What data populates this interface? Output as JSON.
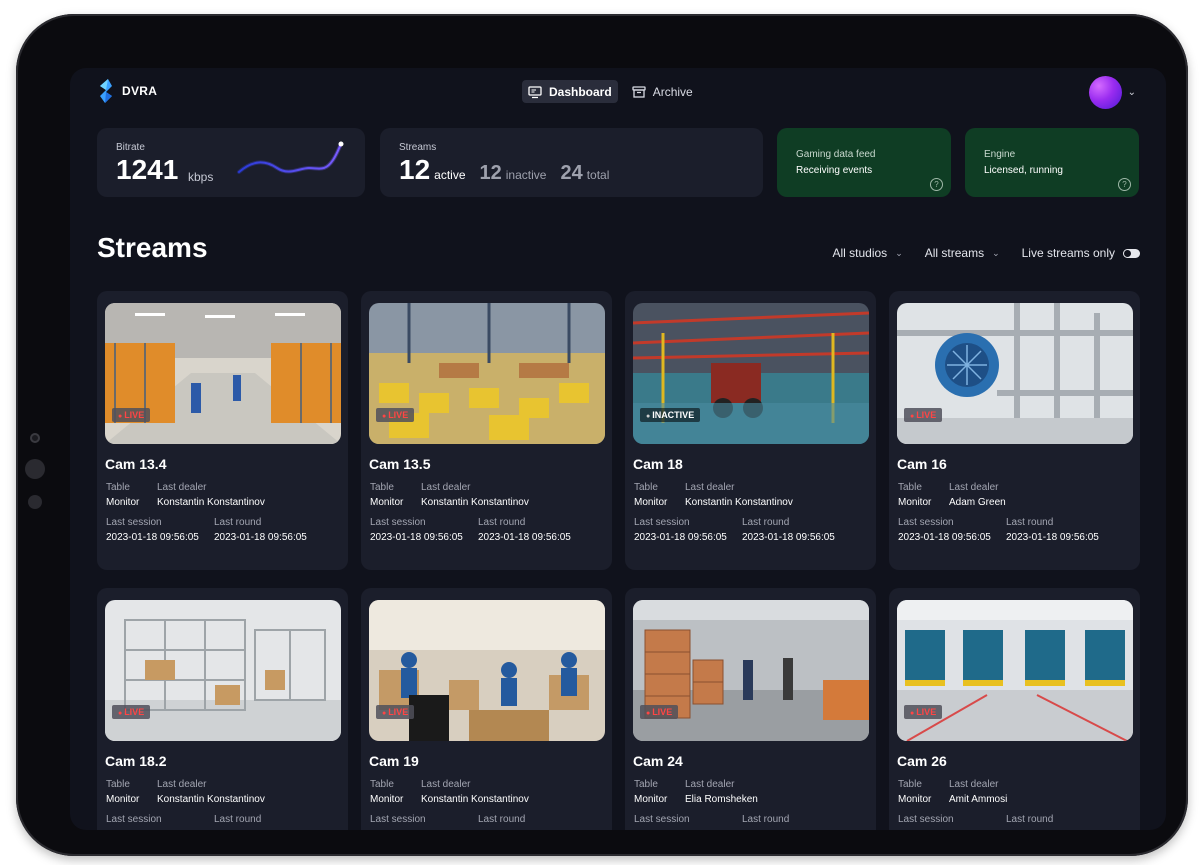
{
  "app": {
    "name": "DVRA"
  },
  "nav": [
    {
      "label": "Dashboard",
      "icon": "monitor-icon",
      "active": true
    },
    {
      "label": "Archive",
      "icon": "archive-box-icon",
      "active": false
    }
  ],
  "stats": {
    "bitrate": {
      "label": "Bitrate",
      "value": "1241",
      "unit": "kbps"
    },
    "streams": {
      "label": "Streams",
      "active": "12",
      "active_label": "active",
      "inactive": "12",
      "inactive_label": "inactive",
      "total": "24",
      "total_label": "total"
    },
    "gaming": {
      "title": "Gaming data feed",
      "status": "Receiving events"
    },
    "engine": {
      "title": "Engine",
      "status": "Licensed, running"
    }
  },
  "page_title": "Streams",
  "filters": {
    "studios": "All studios",
    "streams": "All streams",
    "live_only": "Live streams only"
  },
  "labels": {
    "table": "Table",
    "last_dealer": "Last dealer",
    "last_session": "Last session",
    "last_round": "Last round"
  },
  "cams": [
    {
      "name": "Cam 13.4",
      "status": "LIVE",
      "table": "Monitor",
      "dealer": "Konstantin Konstantinov",
      "session": "2023-01-18 09:56:05",
      "round": "2023-01-18 09:56:05"
    },
    {
      "name": "Cam 13.5",
      "status": "LIVE",
      "table": "Monitor",
      "dealer": "Konstantin Konstantinov",
      "session": "2023-01-18 09:56:05",
      "round": "2023-01-18 09:56:05"
    },
    {
      "name": "Cam 18",
      "status": "INACTIVE",
      "table": "Monitor",
      "dealer": "Konstantin Konstantinov",
      "session": "2023-01-18 09:56:05",
      "round": "2023-01-18 09:56:05"
    },
    {
      "name": "Cam 16",
      "status": "LIVE",
      "table": "Monitor",
      "dealer": "Adam Green",
      "session": "2023-01-18 09:56:05",
      "round": "2023-01-18 09:56:05"
    },
    {
      "name": "Cam 18.2",
      "status": "LIVE",
      "table": "Monitor",
      "dealer": "Konstantin Konstantinov",
      "session": "",
      "round": ""
    },
    {
      "name": "Cam 19",
      "status": "LIVE",
      "table": "Monitor",
      "dealer": "Konstantin Konstantinov",
      "session": "",
      "round": ""
    },
    {
      "name": "Cam 24",
      "status": "LIVE",
      "table": "Monitor",
      "dealer": "Elia Romsheken",
      "session": "",
      "round": ""
    },
    {
      "name": "Cam 26",
      "status": "LIVE",
      "table": "Monitor",
      "dealer": "Amit Ammosi",
      "session": "",
      "round": ""
    }
  ],
  "colors": {
    "bg": "#10121c",
    "card": "#1b1e2b",
    "green_card": "#0f3d24",
    "live": "#ff4545",
    "spark": "#5a4cff"
  }
}
